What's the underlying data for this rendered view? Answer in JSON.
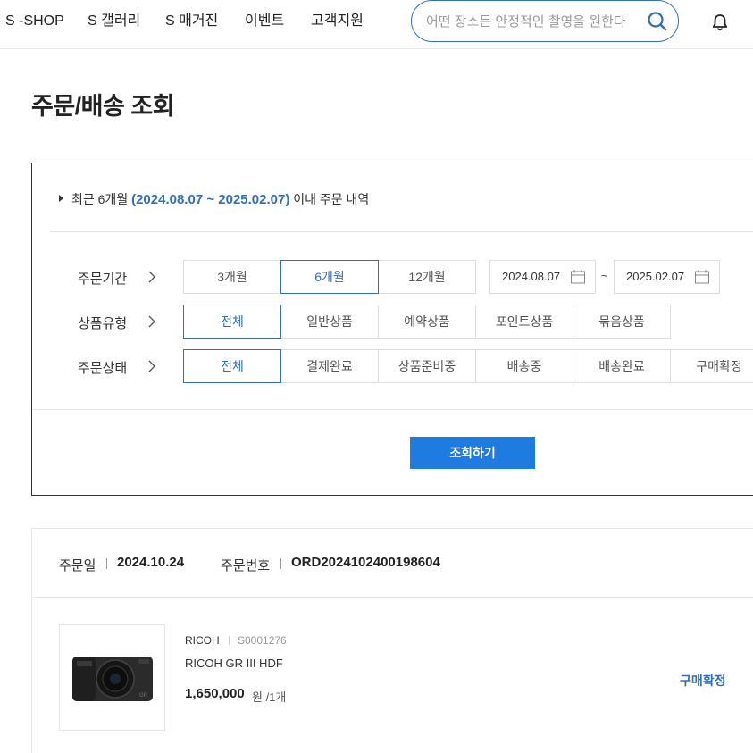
{
  "nav": {
    "items": [
      {
        "label": "S -SHOP"
      },
      {
        "label": "S 갤러리"
      },
      {
        "label": "S 매거진"
      },
      {
        "label": "이벤트"
      },
      {
        "label": "고객지원"
      }
    ],
    "search_placeholder": "어떤 장소든 안정적인 촬영을 원한다"
  },
  "page": {
    "title": "주문/배송 조회"
  },
  "filter": {
    "note_prefix": "최근 6개월",
    "note_range": "(2024.08.07 ~ 2025.02.07)",
    "note_suffix": "이내 주문 내역",
    "period": {
      "label": "주문기간",
      "options": [
        {
          "label": "3개월"
        },
        {
          "label": "6개월"
        },
        {
          "label": "12개월"
        }
      ],
      "selected": "6개월",
      "start_date": "2024.08.07",
      "end_date": "2025.02.07",
      "separator": "~"
    },
    "product_type": {
      "label": "상품유형",
      "options": [
        {
          "label": "전체"
        },
        {
          "label": "일반상품"
        },
        {
          "label": "예약상품"
        },
        {
          "label": "포인트상품"
        },
        {
          "label": "묶음상품"
        }
      ],
      "selected": "전체"
    },
    "order_status": {
      "label": "주문상태",
      "options": [
        {
          "label": "전체"
        },
        {
          "label": "결제완료"
        },
        {
          "label": "상품준비중"
        },
        {
          "label": "배송중"
        },
        {
          "label": "배송완료"
        },
        {
          "label": "구매확정"
        }
      ],
      "selected": "전체"
    },
    "submit_label": "조회하기"
  },
  "order": {
    "date_label": "주문일",
    "date": "2024.10.24",
    "number_label": "주문번호",
    "number": "ORD2024102400198604",
    "item": {
      "brand": "RICOH",
      "sku": "S0001276",
      "name": "RICOH GR III HDF",
      "price": "1,650,000",
      "unit": "원 /1개",
      "status": "구매확정"
    }
  },
  "colors": {
    "accent": "#2f6fb8",
    "button": "#1e7be0"
  }
}
